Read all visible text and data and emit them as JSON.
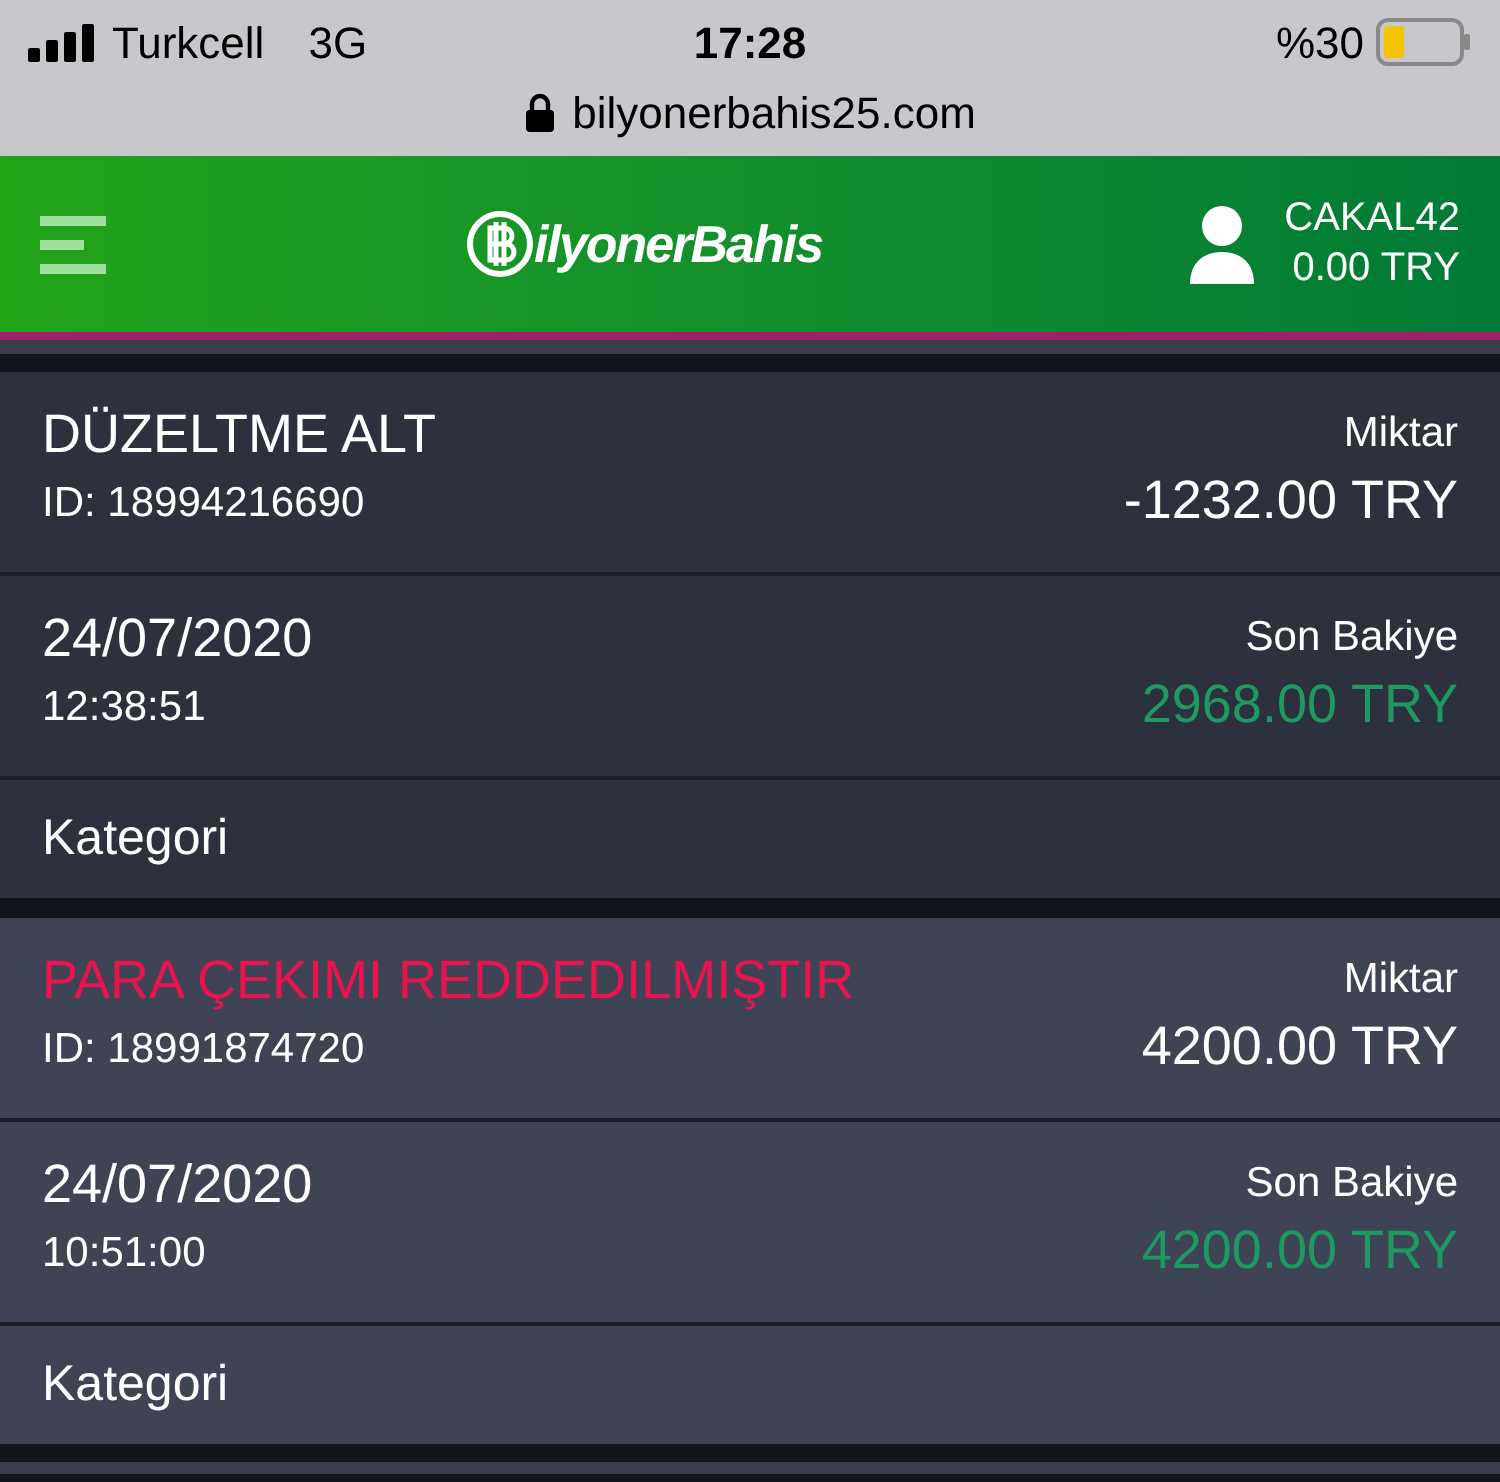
{
  "status_bar": {
    "carrier": "Turkcell",
    "network": "3G",
    "time": "17:28",
    "battery": "%30"
  },
  "address_bar": {
    "url": "bilyonerbahis25.com"
  },
  "header": {
    "logo": "ilyonerBahis",
    "username": "CAKAL42",
    "balance": "0.00 TRY"
  },
  "transactions": [
    {
      "kind": "normal",
      "title": "DÜZELTME ALT",
      "id": "ID: 18994216690",
      "amount_label": "Miktar",
      "amount": "-1232.00 TRY",
      "date": "24/07/2020",
      "time": "12:38:51",
      "balance_label": "Son Bakiye",
      "balance": "2968.00 TRY",
      "category_label": "Kategori"
    },
    {
      "kind": "rejected",
      "title": "PARA ÇEKIMI REDDEDILMIŞTIR",
      "id": "ID: 18991874720",
      "amount_label": "Miktar",
      "amount": "4200.00 TRY",
      "date": "24/07/2020",
      "time": "10:51:00",
      "balance_label": "Son Bakiye",
      "balance": "4200.00 TRY",
      "category_label": "Kategori"
    }
  ]
}
